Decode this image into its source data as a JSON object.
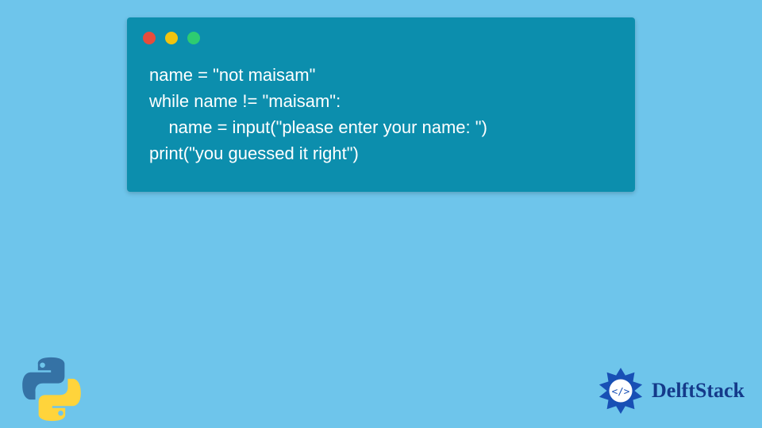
{
  "window": {
    "dot_colors": {
      "red": "#e74c3c",
      "yellow": "#f1c40f",
      "green": "#2ecc71"
    }
  },
  "code": {
    "line1": "name = \"not maisam\"",
    "line2": "while name != \"maisam\":",
    "line3": "    name = input(\"please enter your name: \")",
    "line4": "print(\"you guessed it right\")"
  },
  "brand": {
    "name": "DelftStack"
  }
}
